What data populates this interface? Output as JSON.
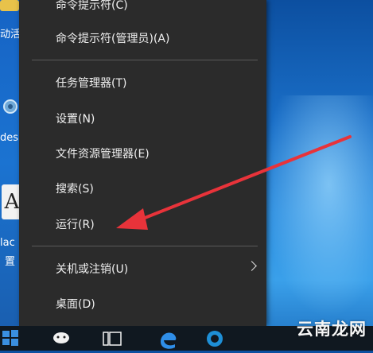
{
  "menu": {
    "items": [
      {
        "label": "命令提示符(C)"
      },
      {
        "label": "命令提示符(管理员)(A)"
      },
      {
        "label": "任务管理器(T)"
      },
      {
        "label": "设置(N)"
      },
      {
        "label": "文件资源管理器(E)"
      },
      {
        "label": "搜索(S)"
      },
      {
        "label": "运行(R)"
      },
      {
        "label": "关机或注销(U)"
      },
      {
        "label": "桌面(D)"
      }
    ]
  },
  "desktop": {
    "labels": [
      "动活",
      "des",
      "lac",
      "置"
    ]
  },
  "annotation": {
    "arrow_color": "#e8333a"
  },
  "watermark": "云南龙网"
}
